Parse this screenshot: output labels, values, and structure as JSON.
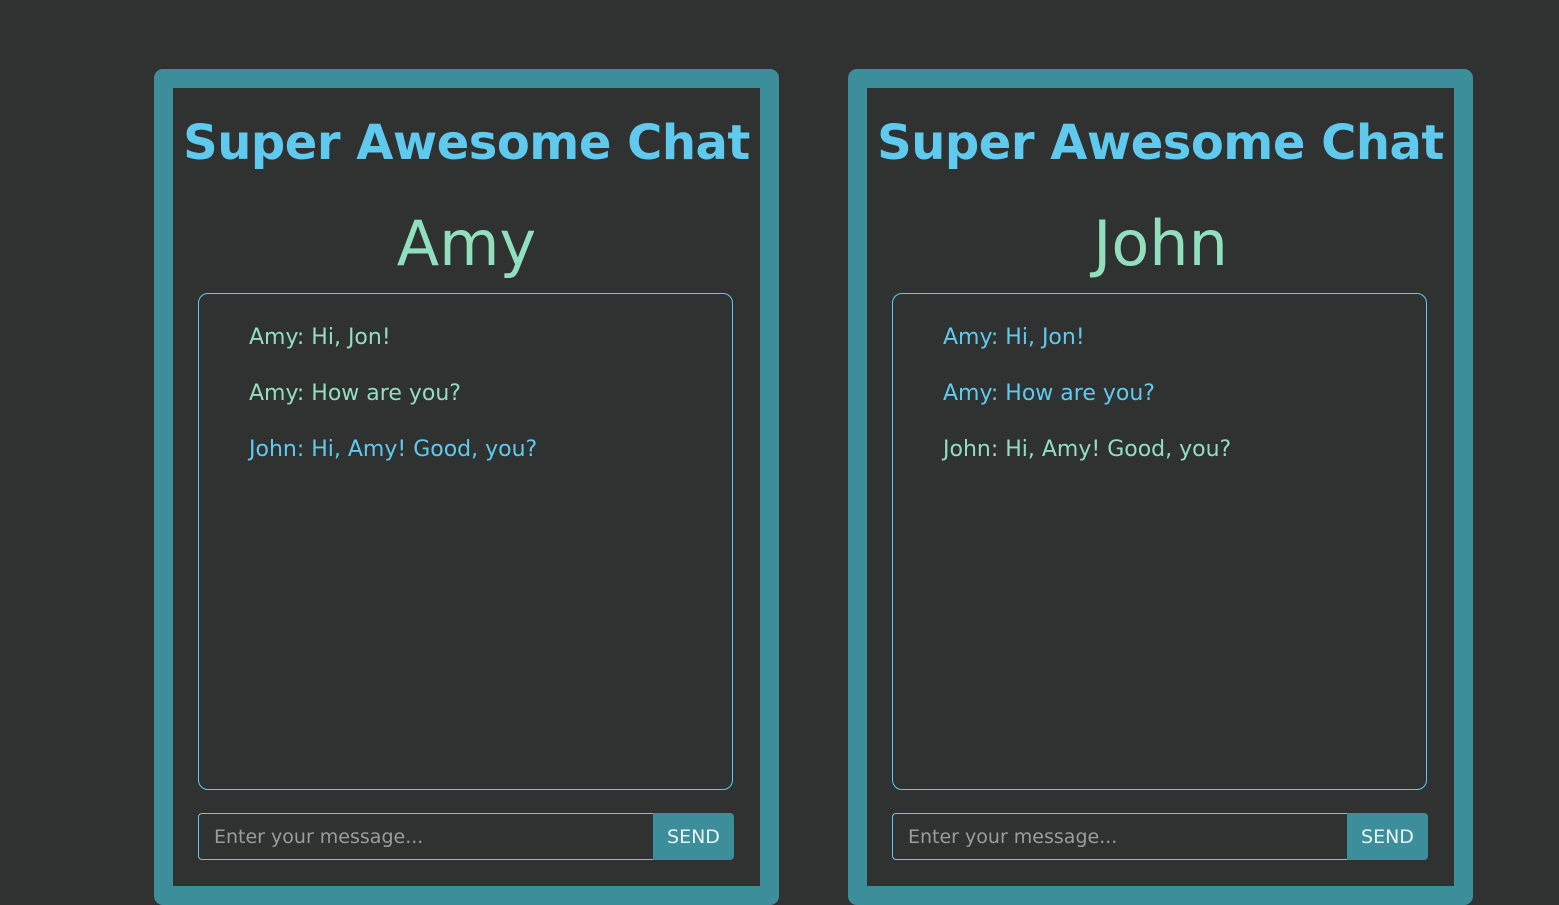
{
  "colors": {
    "background": "#303232",
    "frame": "#3c8f9a",
    "accent_blue": "#5fcaee",
    "accent_green": "#92dfbf"
  },
  "chats": [
    {
      "title": "Super Awesome Chat",
      "user": "Amy",
      "messages": [
        {
          "text": "Amy: Hi, Jon!",
          "color": "#92dfbf"
        },
        {
          "text": "Amy: How are you?",
          "color": "#92dfbf"
        },
        {
          "text": "John: Hi, Amy! Good, you?",
          "color": "#5fcaee"
        }
      ],
      "input_placeholder": "Enter your message...",
      "input_value": "",
      "send_label": "SEND"
    },
    {
      "title": "Super Awesome Chat",
      "user": "John",
      "messages": [
        {
          "text": "Amy: Hi, Jon!",
          "color": "#5fcaee"
        },
        {
          "text": "Amy: How are you?",
          "color": "#5fcaee"
        },
        {
          "text": "John: Hi, Amy! Good, you?",
          "color": "#92dfbf"
        }
      ],
      "input_placeholder": "Enter your message...",
      "input_value": "",
      "send_label": "SEND"
    }
  ]
}
